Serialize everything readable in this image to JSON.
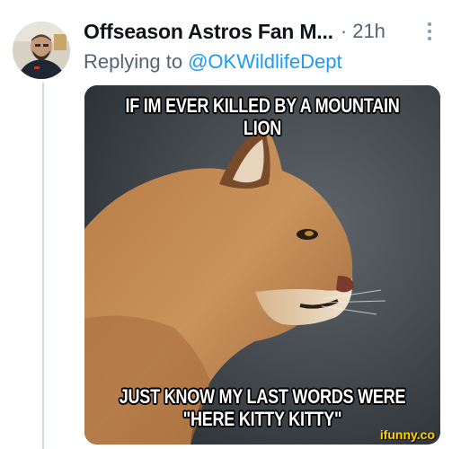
{
  "tweet": {
    "author_name": "Offseason Astros Fan M...",
    "separator": "·",
    "timestamp": "21h",
    "reply_label": "Replying to",
    "reply_handle": "@OKWildlifeDept",
    "more_icon": "more-vertical-icon"
  },
  "meme": {
    "top_caption": "IF IM EVER KILLED BY A MOUNTAIN LION",
    "bottom_caption": "JUST KNOW MY LAST WORDS WERE \"HERE KITTY KITTY\"",
    "watermark": "ifunny.co"
  },
  "colors": {
    "link": "#1d9bf0",
    "muted": "#536471",
    "text": "#0f1419",
    "watermark": "#ffd200"
  }
}
